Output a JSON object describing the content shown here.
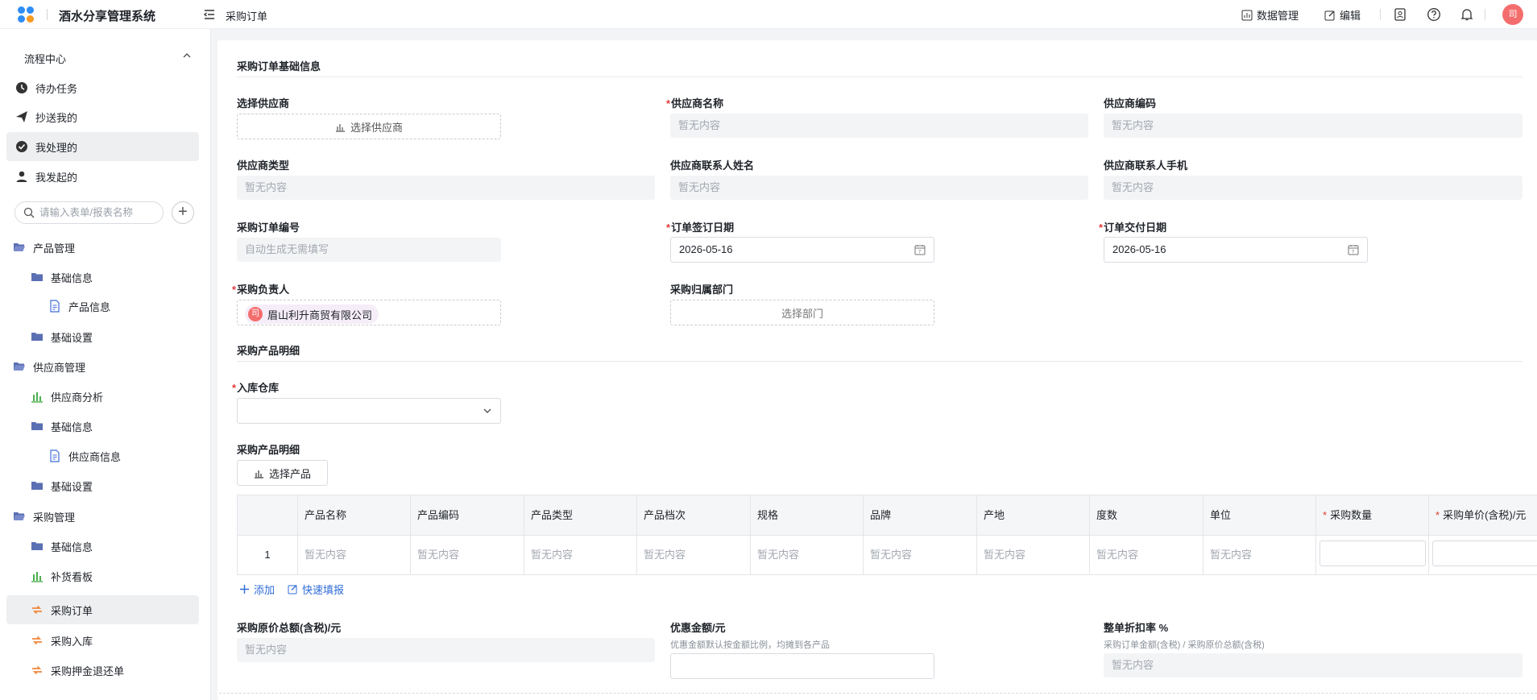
{
  "app": {
    "title": "酒水分享管理系统"
  },
  "header": {
    "page_tab": "采购订单",
    "data_manage": "数据管理",
    "edit": "编辑",
    "avatar_text": "司"
  },
  "sidebar": {
    "section_title": "流程中心",
    "flow_items": [
      {
        "label": "待办任务",
        "icon": "todo-icon"
      },
      {
        "label": "抄送我的",
        "icon": "send-icon"
      },
      {
        "label": "我处理的",
        "icon": "check-circle-icon",
        "active": true
      },
      {
        "label": "我发起的",
        "icon": "user-icon"
      }
    ],
    "search_placeholder": "请输入表单/报表名称",
    "tree": [
      {
        "label": "产品管理",
        "icon": "folder-open-icon",
        "level": 0
      },
      {
        "label": "基础信息",
        "icon": "folder-icon",
        "level": 1
      },
      {
        "label": "产品信息",
        "icon": "document-icon",
        "level": 2
      },
      {
        "label": "基础设置",
        "icon": "folder-icon",
        "level": 1
      },
      {
        "label": "供应商管理",
        "icon": "folder-open-icon",
        "level": 0
      },
      {
        "label": "供应商分析",
        "icon": "bar-chart-icon",
        "level": 1
      },
      {
        "label": "基础信息",
        "icon": "folder-icon",
        "level": 1
      },
      {
        "label": "供应商信息",
        "icon": "document-icon",
        "level": 2
      },
      {
        "label": "基础设置",
        "icon": "folder-icon",
        "level": 1
      },
      {
        "label": "采购管理",
        "icon": "folder-open-icon",
        "level": 0
      },
      {
        "label": "基础信息",
        "icon": "folder-icon",
        "level": 1
      },
      {
        "label": "补货看板",
        "icon": "bar-chart-icon",
        "level": 1
      },
      {
        "label": "采购订单",
        "icon": "flow-icon",
        "level": 1,
        "active": true
      },
      {
        "label": "采购入库",
        "icon": "flow-icon",
        "level": 1
      },
      {
        "label": "采购押金退还单",
        "icon": "flow-icon",
        "level": 1
      }
    ]
  },
  "form": {
    "section_basic": "采购订单基础信息",
    "select_supplier_label": "选择供应商",
    "select_supplier_btn": "选择供应商",
    "supplier_name_label": "供应商名称",
    "supplier_name_value": "暂无内容",
    "supplier_code_label": "供应商编码",
    "supplier_code_value": "暂无内容",
    "supplier_type_label": "供应商类型",
    "supplier_type_value": "暂无内容",
    "contact_name_label": "供应商联系人姓名",
    "contact_name_value": "暂无内容",
    "contact_phone_label": "供应商联系人手机",
    "contact_phone_value": "暂无内容",
    "order_no_label": "采购订单编号",
    "order_no_value": "自动生成无需填写",
    "sign_date_label": "订单签订日期",
    "sign_date_value": "2026-05-16",
    "delivery_date_label": "订单交付日期",
    "delivery_date_value": "2026-05-16",
    "owner_label": "采购负责人",
    "owner_avatar": "司",
    "owner_value": "眉山利升商贸有限公司",
    "dept_label": "采购归属部门",
    "dept_btn": "选择部门",
    "section_detail": "采购产品明细",
    "warehouse_label": "入库仓库",
    "detail_label": "采购产品明细",
    "select_product_btn": "选择产品",
    "table": {
      "columns": [
        "产品名称",
        "产品编码",
        "产品类型",
        "产品档次",
        "规格",
        "品牌",
        "产地",
        "度数",
        "单位",
        "采购数量",
        "采购单价(含税)/元"
      ],
      "rows": [
        {
          "index": "1",
          "cells": [
            "暂无内容",
            "暂无内容",
            "暂无内容",
            "暂无内容",
            "暂无内容",
            "暂无内容",
            "暂无内容",
            "暂无内容",
            "暂无内容"
          ]
        }
      ]
    },
    "add_link": "添加",
    "quick_fill_link": "快速填报",
    "original_total_label": "采购原价总额(含税)/元",
    "original_total_value": "暂无内容",
    "discount_label": "优惠金额/元",
    "discount_hint": "优惠金额默认按金额比例，均摊到各产品",
    "rate_label": "整单折扣率 %",
    "rate_hint": "采购订单金额(含税) / 采购原价总额(含税)",
    "rate_value": "暂无内容"
  },
  "colors": {
    "accent": "#2f6bd8",
    "required": "#e23b3b",
    "avatar": "#f46d6d",
    "folder": "#5b6fb3",
    "chart": "#4caf50",
    "flow": "#f0883a"
  }
}
